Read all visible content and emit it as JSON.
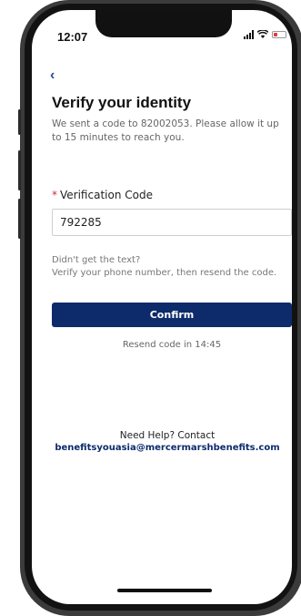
{
  "status_bar": {
    "time": "12:07"
  },
  "nav": {
    "back_label": "‹"
  },
  "verify": {
    "title": "Verify your identity",
    "subtitle": "We sent a code to 82002053. Please allow it up to 15 minutes to reach you.",
    "field_required_mark": "*",
    "field_label": "Verification Code",
    "code_value": "792285",
    "help_line1": "Didn't get the text?",
    "help_line2": "Verify your phone number, then resend the code.",
    "confirm_label": "Confirm",
    "resend_text": "Resend code in 14:45"
  },
  "support": {
    "help_text": "Need Help? Contact",
    "email": "benefitsyouasia@mercermarshbenefits.com"
  },
  "colors": {
    "primary": "#0d2b6b",
    "link": "#1f4e9c",
    "required": "#d32f2f"
  }
}
